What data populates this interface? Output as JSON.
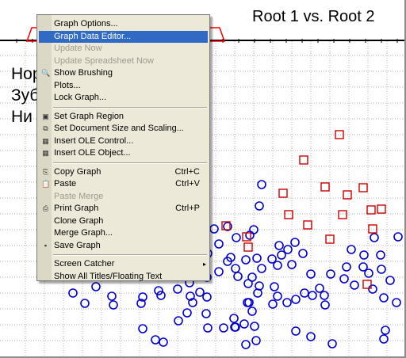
{
  "graph": {
    "title": "Root 1 vs. Root 2",
    "bg_labels": [
      "Нор",
      "Зуб",
      "Ни"
    ]
  },
  "colors": {
    "menu_bg": "#ece9d8",
    "highlight": "#316ac5",
    "blue_series": "#0000cc",
    "red_series": "#cc0000",
    "highlight_outline": "#ff0000"
  },
  "context_menu": {
    "items": [
      {
        "label": "Graph Options...",
        "enabled": true
      },
      {
        "label": "Graph Data Editor...",
        "enabled": true,
        "highlighted": true
      },
      {
        "label": "Update Now",
        "enabled": false
      },
      {
        "label": "Update Spreadsheet Now",
        "enabled": false
      },
      {
        "label": "Show Brushing",
        "enabled": true,
        "icon": "brush-icon"
      },
      {
        "label": "Plots...",
        "enabled": true
      },
      {
        "label": "Lock Graph...",
        "enabled": true
      },
      {
        "separator": true
      },
      {
        "label": "Set Graph Region",
        "enabled": true,
        "icon": "graph-region-icon"
      },
      {
        "label": "Set Document Size and Scaling...",
        "enabled": true,
        "icon": "document-size-icon"
      },
      {
        "label": "Insert OLE Control...",
        "enabled": true,
        "icon": "ole-control-icon"
      },
      {
        "label": "Insert OLE Object...",
        "enabled": true,
        "icon": "ole-object-icon"
      },
      {
        "separator": true
      },
      {
        "label": "Copy Graph",
        "shortcut": "Ctrl+C",
        "enabled": true,
        "icon": "copy-icon"
      },
      {
        "label": "Paste",
        "shortcut": "Ctrl+V",
        "enabled": true,
        "icon": "paste-icon"
      },
      {
        "label": "Paste Merge",
        "enabled": false
      },
      {
        "label": "Print Graph",
        "shortcut": "Ctrl+P",
        "enabled": true,
        "icon": "printer-icon"
      },
      {
        "label": "Clone Graph",
        "enabled": true
      },
      {
        "label": "Merge Graph...",
        "enabled": true
      },
      {
        "label": "Save Graph",
        "enabled": true,
        "icon": "floppy-disk-icon"
      },
      {
        "separator": true
      },
      {
        "label": "Screen Catcher",
        "enabled": true,
        "submenu": true
      },
      {
        "label": "Show All Titles/Floating Text",
        "enabled": true
      }
    ]
  },
  "chart_data": {
    "type": "scatter",
    "title": "Root 1 vs. Root 2",
    "xlabel": "",
    "ylabel": "",
    "grid": true,
    "series": [
      {
        "marker": "circle",
        "color": "#0000cc",
        "points": [
          [
            330,
            233
          ],
          [
            327,
            260
          ],
          [
            315,
            297
          ],
          [
            320,
            290
          ],
          [
            287,
            286
          ],
          [
            270,
            289
          ],
          [
            298,
            300
          ],
          [
            276,
            308
          ],
          [
            255,
            310
          ],
          [
            262,
            320
          ],
          [
            291,
            325
          ],
          [
            297,
            339
          ],
          [
            300,
            349
          ],
          [
            287,
            330
          ],
          [
            310,
            328
          ],
          [
            324,
            326
          ],
          [
            343,
            327
          ],
          [
            355,
            322
          ],
          [
            352,
            310
          ],
          [
            372,
            306
          ],
          [
            363,
            315
          ],
          [
            382,
            320
          ],
          [
            368,
            334
          ],
          [
            350,
            335
          ],
          [
            330,
            339
          ],
          [
            318,
            350
          ],
          [
            346,
            362
          ],
          [
            327,
            361
          ],
          [
            313,
            358
          ],
          [
            325,
            370
          ],
          [
            314,
            382
          ],
          [
            344,
            384
          ],
          [
            362,
            382
          ],
          [
            350,
            374
          ],
          [
            373,
            378
          ],
          [
            384,
            370
          ],
          [
            394,
            373
          ],
          [
            392,
            346
          ],
          [
            403,
            364
          ],
          [
            409,
            373
          ],
          [
            417,
            346
          ],
          [
            434,
            352
          ],
          [
            447,
            360
          ],
          [
            437,
            337
          ],
          [
            443,
            315
          ],
          [
            459,
            322
          ],
          [
            480,
            322
          ],
          [
            458,
            337
          ],
          [
            465,
            345
          ],
          [
            481,
            340
          ],
          [
            502,
            299
          ],
          [
            492,
            354
          ],
          [
            470,
            365
          ],
          [
            484,
            376
          ],
          [
            472,
            300
          ],
          [
            295,
            402
          ],
          [
            297,
            413
          ],
          [
            308,
            409
          ],
          [
            321,
            412
          ],
          [
            323,
            430
          ],
          [
            318,
            393
          ],
          [
            312,
            382
          ],
          [
            276,
            343
          ],
          [
            261,
            350
          ],
          [
            252,
            369
          ],
          [
            224,
            365
          ],
          [
            223,
            337
          ],
          [
            211,
            331
          ],
          [
            239,
            357
          ],
          [
            261,
            375
          ],
          [
            243,
            382
          ],
          [
            240,
            374
          ],
          [
            236,
            395
          ],
          [
            260,
            396
          ],
          [
            225,
            405
          ],
          [
            203,
            373
          ],
          [
            200,
            367
          ],
          [
            180,
            375
          ],
          [
            178,
            383
          ],
          [
            141,
            374
          ],
          [
            143,
            385
          ],
          [
            121,
            362
          ],
          [
            92,
            370
          ],
          [
            107,
            383
          ],
          [
            180,
            415
          ],
          [
            196,
            429
          ],
          [
            206,
            432
          ],
          [
            262,
            414
          ],
          [
            282,
            414
          ],
          [
            296,
            413
          ],
          [
            310,
            435
          ],
          [
            373,
            418
          ],
          [
            392,
            425
          ],
          [
            419,
            434
          ],
          [
            486,
            417
          ],
          [
            484,
            428
          ],
          [
            410,
            385
          ],
          [
            500,
            382
          ]
        ]
      },
      {
        "marker": "square",
        "color": "#cc0000",
        "points": [
          [
            428,
            170
          ],
          [
            383,
            202
          ],
          [
            410,
            236
          ],
          [
            438,
            246
          ],
          [
            468,
            265
          ],
          [
            481,
            264
          ],
          [
            458,
            237
          ],
          [
            432,
            271
          ],
          [
            416,
            302
          ],
          [
            388,
            284
          ],
          [
            364,
            271
          ],
          [
            357,
            244
          ],
          [
            285,
            285
          ],
          [
            311,
            299
          ],
          [
            313,
            312
          ],
          [
            470,
            289
          ],
          [
            463,
            359
          ]
        ]
      }
    ]
  }
}
